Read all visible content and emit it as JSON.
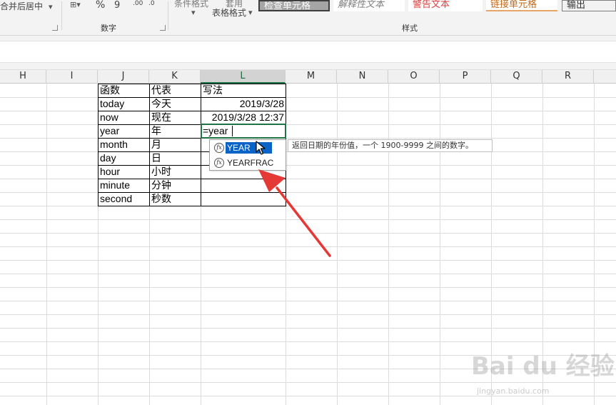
{
  "ribbon": {
    "merge_center": "合并后居中",
    "number_group": "数字",
    "percent": "%",
    "comma": "9",
    "inc_decimal": ".00",
    "dec_decimal": ".0",
    "cond_format": "条件格式",
    "table_format_top": "套用",
    "table_format_bottom": "表格格式",
    "styles_group": "样式",
    "styles": {
      "check_cell": "检查单元格",
      "explanatory": "解释性文本",
      "warning": "警告文本",
      "linked_cell": "链接单元格",
      "output": "输出"
    }
  },
  "columns": [
    "H",
    "I",
    "J",
    "K",
    "L",
    "M",
    "N",
    "O",
    "P",
    "Q",
    "R"
  ],
  "active_column": "L",
  "table": {
    "rows": [
      {
        "j": "函数",
        "k": "代表",
        "l": "写法"
      },
      {
        "j": "today",
        "k": "今天",
        "l": "2019/3/28"
      },
      {
        "j": "now",
        "k": "现在",
        "l": "2019/3/28 12:37"
      },
      {
        "j": "year",
        "k": "年",
        "l": ""
      },
      {
        "j": "month",
        "k": "月",
        "l": ""
      },
      {
        "j": "day",
        "k": "日",
        "l": ""
      },
      {
        "j": "hour",
        "k": "小时",
        "l": ""
      },
      {
        "j": "minute",
        "k": "分钟",
        "l": ""
      },
      {
        "j": "second",
        "k": "秒数",
        "l": ""
      }
    ]
  },
  "editing": {
    "formula_text": "=year"
  },
  "autocomplete": {
    "items": [
      {
        "label": "YEAR",
        "icon": "fx-function-icon",
        "selected": true
      },
      {
        "label": "YEARFRAC",
        "icon": "fx-function-icon",
        "selected": false
      }
    ],
    "tooltip": "返回日期的年份值，一个 1900-9999 之间的数字。"
  },
  "watermark": {
    "brand": "Bai du 经验",
    "url": "jingyan.baidu.com"
  },
  "colors": {
    "accent": "#217346",
    "selection": "#0a64c8",
    "annotation_arrow": "#e53935"
  }
}
